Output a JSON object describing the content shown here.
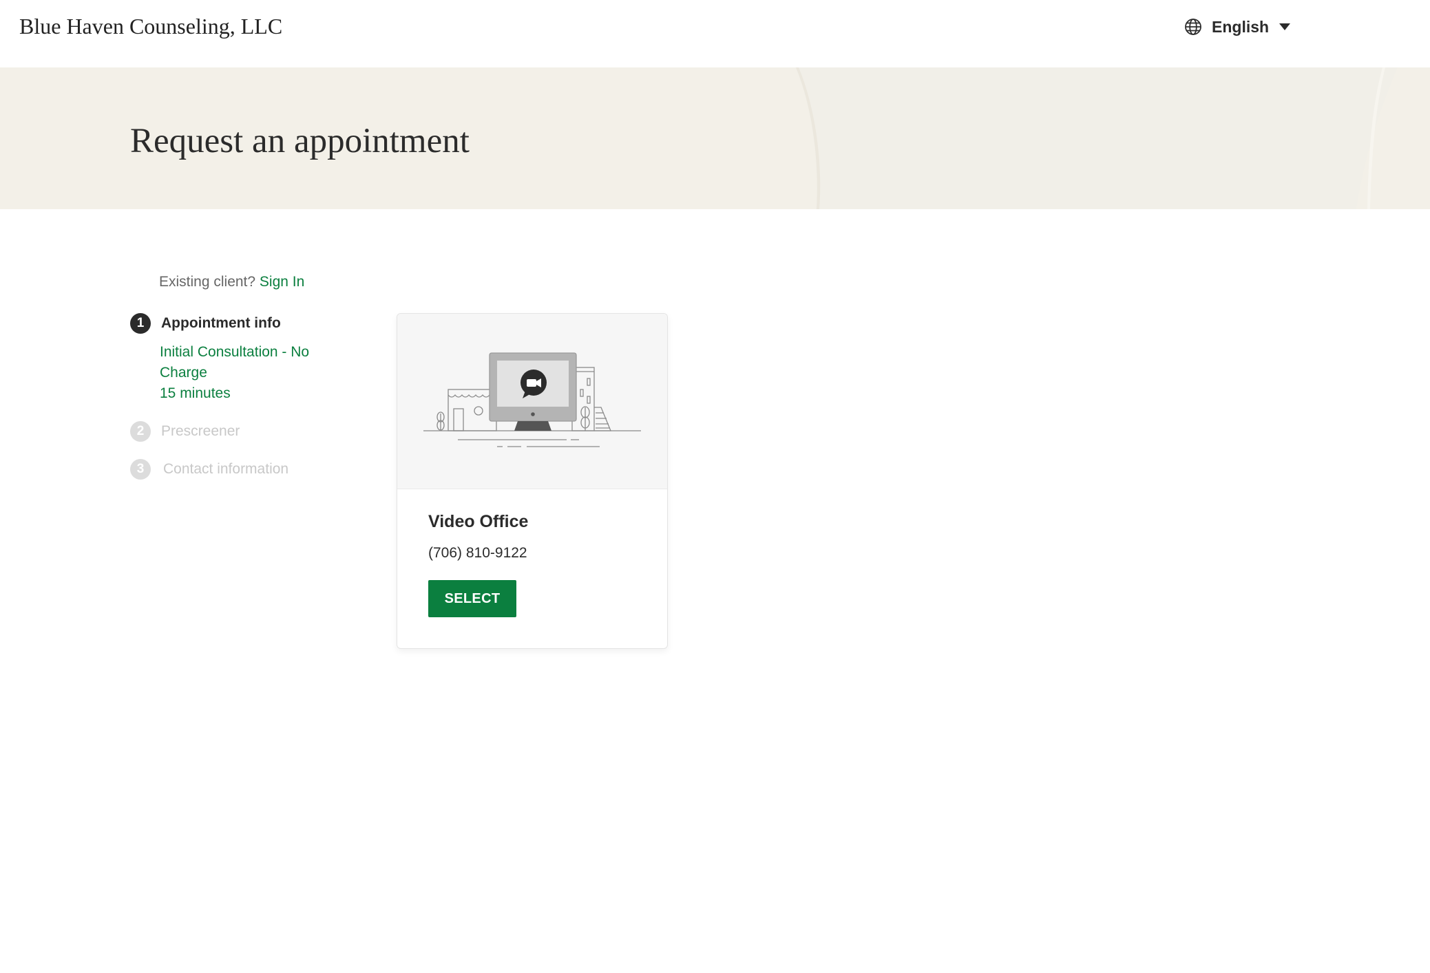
{
  "header": {
    "brand": "Blue Haven Counseling, LLC",
    "language": {
      "label": "English",
      "icon": "globe-icon",
      "caret_icon": "caret-down-icon"
    }
  },
  "hero": {
    "title": "Request an appointment"
  },
  "sidebar": {
    "existing_prefix": "Existing client?",
    "sign_in_label": "Sign In",
    "steps": [
      {
        "number": "1",
        "label": "Appointment info"
      },
      {
        "number": "2",
        "label": "Prescreener"
      },
      {
        "number": "3",
        "label": "Contact information"
      }
    ],
    "appointment_details": {
      "service": "Initial Consultation - No Charge",
      "duration": "15 minutes"
    }
  },
  "location_card": {
    "illustration": "video-office-illustration",
    "title": "Video Office",
    "phone": "(706) 810-9122",
    "select_label": "SELECT"
  },
  "colors": {
    "accent_green": "#0b7f3f",
    "hero_bg": "#f3f0e8",
    "text_dark": "#2b2b2b",
    "step_inactive": "#dcdcdc"
  }
}
